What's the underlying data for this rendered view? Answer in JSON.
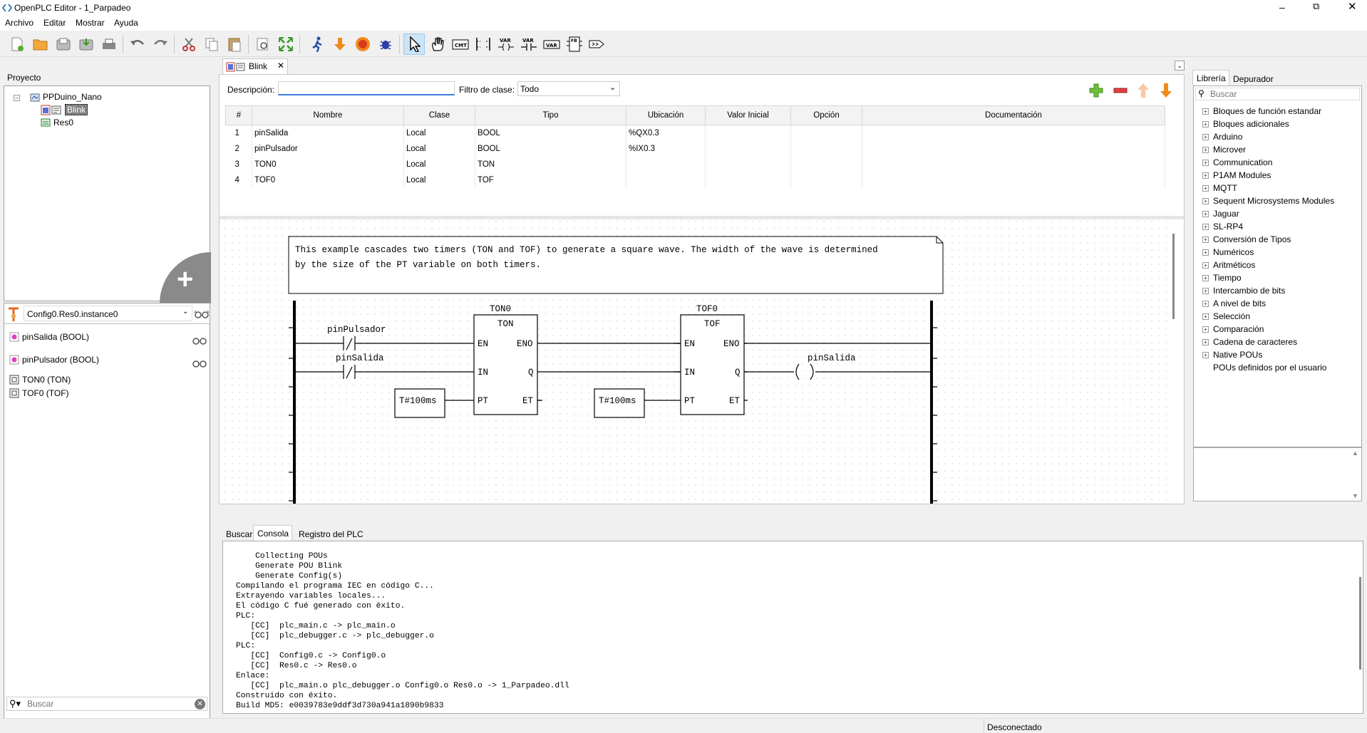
{
  "window": {
    "title": "OpenPLC Editor - 1_Parpadeo"
  },
  "menu": [
    "Archivo",
    "Editar",
    "Mostrar",
    "Ayuda"
  ],
  "toolbar": {
    "icons": [
      "new-file",
      "open-folder",
      "save",
      "save-as",
      "print",
      "undo",
      "redo",
      "cut",
      "copy",
      "paste",
      "find",
      "fullscreen",
      "run",
      "download",
      "stop",
      "debug",
      "select-pointer",
      "hand",
      "comment",
      "variable",
      "contact",
      "coil",
      "var-block",
      "function-block",
      "branch"
    ]
  },
  "project_panel": {
    "tab": "Proyecto",
    "root": "PPDuino_Nano",
    "items": [
      "Blink",
      "Res0"
    ]
  },
  "instance_panel": {
    "selector": "Config0.Res0.instance0",
    "vars": [
      "pinSalida (BOOL)",
      "pinPulsador (BOOL)",
      "TON0 (TON)",
      "TOF0 (TOF)"
    ]
  },
  "search_left": {
    "placeholder": "Buscar"
  },
  "editor": {
    "tab": "Blink",
    "desc_label": "Descripción:",
    "desc_value": "",
    "filter_label": "Filtro de clase:",
    "filter_value": "Todo",
    "columns": [
      "#",
      "Nombre",
      "Clase",
      "Tipo",
      "Ubicación",
      "Valor Inicial",
      "Opción",
      "Documentación"
    ],
    "rows": [
      [
        "1",
        "pinSalida",
        "Local",
        "BOOL",
        "%QX0.3",
        "",
        "",
        ""
      ],
      [
        "2",
        "pinPulsador",
        "Local",
        "BOOL",
        "%IX0.3",
        "",
        "",
        ""
      ],
      [
        "3",
        "TON0",
        "Local",
        "TON",
        "",
        "",
        "",
        ""
      ],
      [
        "4",
        "TOF0",
        "Local",
        "TOF",
        "",
        "",
        "",
        ""
      ]
    ]
  },
  "ladder": {
    "comment_line1": "This example cascades two timers (TON and TOF) to generate a square wave. The width of the wave is determined",
    "comment_line2": "by the size of the PT variable on both timers.",
    "contact1": "pinPulsador",
    "contact2": "pinSalida",
    "ton_instance": "TON0",
    "ton_type": "TON",
    "tof_instance": "TOF0",
    "tof_type": "TOF",
    "pins": {
      "en": "EN",
      "eno": "ENO",
      "in": "IN",
      "q": "Q",
      "pt": "PT",
      "et": "ET"
    },
    "pt1": "T#100ms",
    "pt2": "T#100ms",
    "coil": "pinSalida",
    "contact_symbol": "/"
  },
  "library": {
    "tabs": [
      "Librería",
      "Depurador"
    ],
    "search_placeholder": "Buscar",
    "items": [
      "Bloques de función estandar",
      "Bloques adicionales",
      "Arduino",
      "Microver",
      "Communication",
      "P1AM Modules",
      "MQTT",
      "Sequent Microsystems Modules",
      "Jaguar",
      "SL-RP4",
      "Conversión de Tipos",
      "Numéricos",
      "Aritméticos",
      "Tiempo",
      "Intercambio de bits",
      "A nivel de bits",
      "Selección",
      "Comparación",
      "Cadena de caracteres",
      "Native POUs",
      "POUs definidos por el usuario"
    ]
  },
  "bottom": {
    "tabs": [
      "Buscar",
      "Consola",
      "Registro del PLC"
    ],
    "console": [
      "    Collecting POUs",
      "    Generate POU Blink",
      "    Generate Config(s)",
      "Compilando el programa IEC en código C...",
      "Extrayendo variables locales...",
      "El código C fué generado con éxito.",
      "PLC:",
      "   [CC]  plc_main.c -> plc_main.o",
      "   [CC]  plc_debugger.c -> plc_debugger.o",
      "PLC:",
      "   [CC]  Config0.c -> Config0.o",
      "   [CC]  Res0.c -> Res0.o",
      "Enlace:",
      "   [CC]  plc_main.o plc_debugger.o Config0.o Res0.o -> 1_Parpadeo.dll",
      "Construido con éxito.",
      "Build MD5: e0039783e9ddf3d730a941a1890b9833"
    ]
  },
  "status": {
    "text": "Desconectado"
  }
}
